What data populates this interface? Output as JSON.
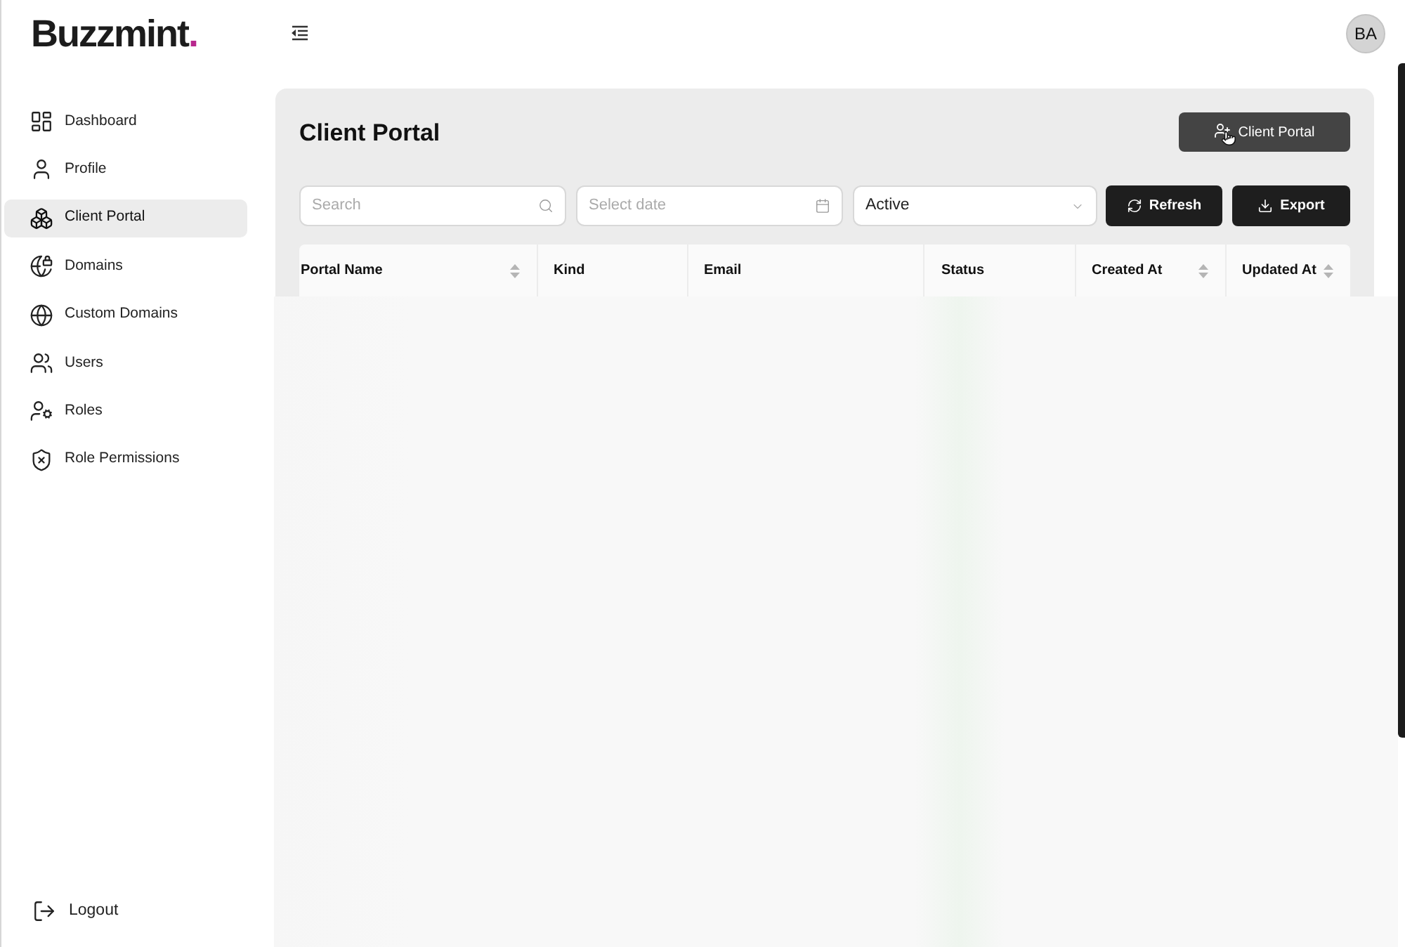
{
  "logo": {
    "name": "Buzzmint",
    "mark": "."
  },
  "user": {
    "initials": "BA"
  },
  "sidebar": {
    "items": [
      {
        "label": "Dashboard",
        "selected": false
      },
      {
        "label": "Profile",
        "selected": false
      },
      {
        "label": "Client Portal",
        "selected": true
      },
      {
        "label": "Domains",
        "selected": false
      },
      {
        "label": "Custom Domains",
        "selected": false
      },
      {
        "label": "Users",
        "selected": false
      },
      {
        "label": "Roles",
        "selected": false
      },
      {
        "label": "Role Permissions",
        "selected": false
      }
    ],
    "logout": {
      "label": "Logout"
    }
  },
  "page": {
    "title": "Client Portal",
    "add_button": {
      "label": "Client Portal"
    }
  },
  "filters": {
    "search": {
      "placeholder": "Search"
    },
    "date": {
      "placeholder": "Select date"
    },
    "status": {
      "value": "Active"
    },
    "buttons": [
      {
        "label": "Refresh"
      },
      {
        "label": "Export"
      }
    ]
  },
  "table": {
    "columns": [
      {
        "label": "Portal Name",
        "sortable": true
      },
      {
        "label": "Kind",
        "sortable": false
      },
      {
        "label": "Email",
        "sortable": false
      },
      {
        "label": "Status",
        "sortable": false
      },
      {
        "label": "Created At",
        "sortable": true
      },
      {
        "label": "Updated At",
        "sortable": true
      }
    ]
  }
}
